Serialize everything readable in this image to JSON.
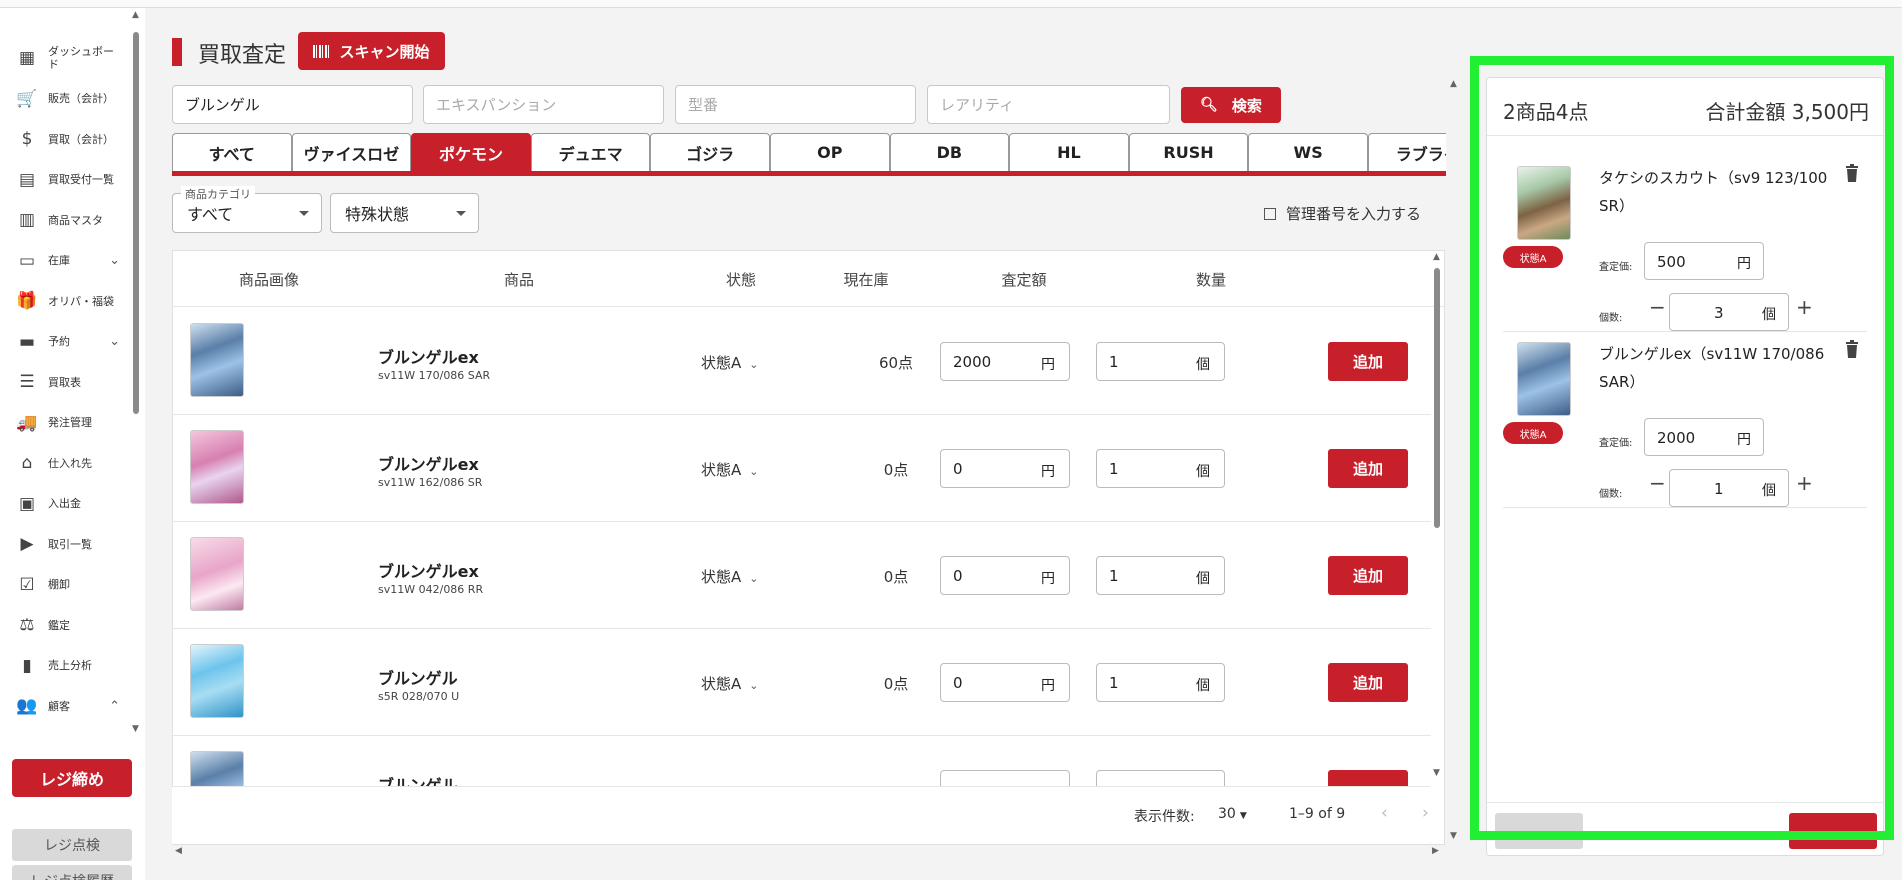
{
  "sidebar": {
    "items": [
      {
        "label": "ダッシュボード",
        "icon": "dashboard-icon",
        "glyph": "▦",
        "chevron": ""
      },
      {
        "label": "販売（会計）",
        "icon": "cart-icon",
        "glyph": "🛒",
        "chevron": ""
      },
      {
        "label": "買取（会計）",
        "icon": "dollar-icon",
        "glyph": "$",
        "chevron": ""
      },
      {
        "label": "買取受付一覧",
        "icon": "receipt-icon",
        "glyph": "▤",
        "chevron": ""
      },
      {
        "label": "商品マスタ",
        "icon": "store-icon",
        "glyph": "▥",
        "chevron": ""
      },
      {
        "label": "在庫",
        "icon": "inventory-icon",
        "glyph": "▭",
        "chevron": "⌄"
      },
      {
        "label": "オリパ・福袋",
        "icon": "gift-icon",
        "glyph": "🎁",
        "chevron": ""
      },
      {
        "label": "予約",
        "icon": "reservation-icon",
        "glyph": "▬",
        "chevron": "⌄"
      },
      {
        "label": "買取表",
        "icon": "list-icon",
        "glyph": "☰",
        "chevron": ""
      },
      {
        "label": "発注管理",
        "icon": "truck-icon",
        "glyph": "🚚",
        "chevron": ""
      },
      {
        "label": "仕入れ先",
        "icon": "supplier-icon",
        "glyph": "⌂",
        "chevron": ""
      },
      {
        "label": "入出金",
        "icon": "register-icon",
        "glyph": "▣",
        "chevron": ""
      },
      {
        "label": "取引一覧",
        "icon": "folder-icon",
        "glyph": "▶",
        "chevron": ""
      },
      {
        "label": "棚卸",
        "icon": "checklist-icon",
        "glyph": "☑",
        "chevron": ""
      },
      {
        "label": "鑑定",
        "icon": "gavel-icon",
        "glyph": "⚖",
        "chevron": ""
      },
      {
        "label": "売上分析",
        "icon": "bar-chart-icon",
        "glyph": "▮",
        "chevron": ""
      },
      {
        "label": "顧客",
        "icon": "customers-icon",
        "glyph": "👥",
        "chevron": "⌃"
      }
    ],
    "close_register": "レジ締め",
    "register_check": "レジ点検",
    "register_check_history": "レジ点検履歴"
  },
  "header": {
    "title": "買取査定",
    "scan_button": "スキャン開始"
  },
  "search": {
    "name_value": "ブルンゲル",
    "expansion_placeholder": "エキスパンション",
    "model_placeholder": "型番",
    "rarity_placeholder": "レアリティ",
    "search_button": "検索"
  },
  "tabs": [
    "すべて",
    "ヴァイスロゼ",
    "ポケモン",
    "デュエマ",
    "ゴジラ",
    "OP",
    "DB",
    "HL",
    "RUSH",
    "WS",
    "ラブライ"
  ],
  "active_tab": 2,
  "filters": {
    "category_legend": "商品カテゴリ",
    "category_value": "すべて",
    "special_state": "特殊状態",
    "manage_no_label": "管理番号を入力する"
  },
  "table": {
    "headers": [
      "商品画像",
      "商品",
      "状態",
      "現在庫",
      "査定額",
      "数量"
    ],
    "rows": [
      {
        "name": "ブルンゲルex",
        "code": "sv11W 170/086 SAR",
        "state": "状態A",
        "stock": "60点",
        "price": "2000",
        "qty": "1",
        "art": "art-blue"
      },
      {
        "name": "ブルンゲルex",
        "code": "sv11W 162/086 SR",
        "state": "状態A",
        "stock": "0点",
        "price": "0",
        "qty": "1",
        "art": "art-pink"
      },
      {
        "name": "ブルンゲルex",
        "code": "sv11W 042/086 RR",
        "state": "状態A",
        "stock": "0点",
        "price": "0",
        "qty": "1",
        "art": "art-pink2"
      },
      {
        "name": "ブルンゲル",
        "code": "s5R 028/070 U",
        "state": "状態A",
        "stock": "0点",
        "price": "0",
        "qty": "1",
        "art": "art-cyan"
      },
      {
        "name": "ブルンゲル",
        "code": "",
        "state": "",
        "stock": "",
        "price": "",
        "qty": "",
        "art": "art-blue"
      }
    ],
    "yen": "円",
    "unit": "個",
    "add_label": "追加"
  },
  "pagination": {
    "rows_label": "表示件数:",
    "rows_per_page": "30",
    "range": "1–9 of 9"
  },
  "cart": {
    "summary": "2商品4点",
    "total": "合計金額 3,500円",
    "items": [
      {
        "name": "タケシのスカウト（sv9 123/100 SR）",
        "badge": "状態A",
        "price_label": "査定価:",
        "price": "500",
        "qty_label": "個数:",
        "qty": "3",
        "art": "art-portrait"
      },
      {
        "name": "ブルンゲルex（sv11W 170/086 SAR）",
        "badge": "状態A",
        "price_label": "査定価:",
        "price": "2000",
        "qty_label": "個数:",
        "qty": "1",
        "art": "art-blue"
      }
    ],
    "yen": "円",
    "unit": "個"
  },
  "colors": {
    "accent": "#c8202a",
    "highlight": "#22ee33"
  }
}
